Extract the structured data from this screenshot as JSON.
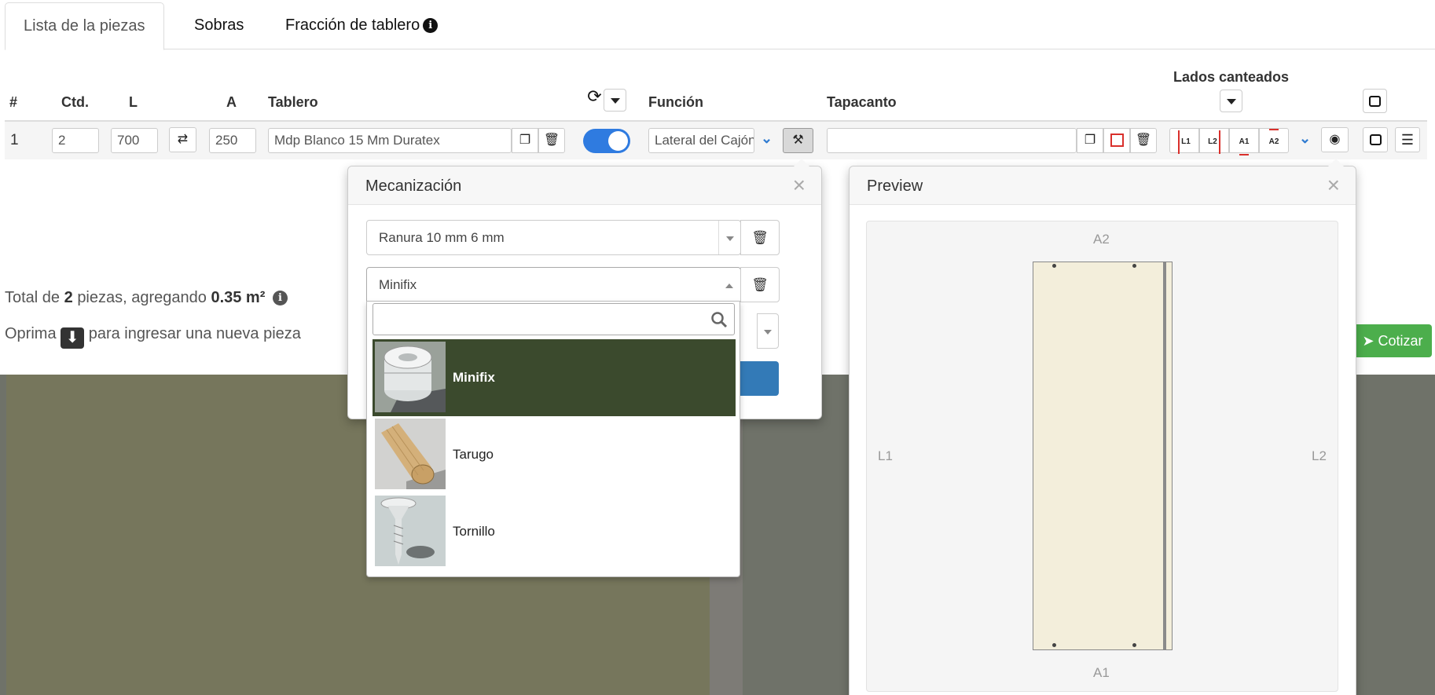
{
  "tabs": [
    {
      "label": "Lista de la piezas"
    },
    {
      "label": "Sobras"
    },
    {
      "label": "Fracción de tablero"
    }
  ],
  "table": {
    "headers": {
      "num": "#",
      "qty": "Ctd.",
      "length": "L",
      "width": "A",
      "board": "Tablero",
      "function": "Función",
      "edge_band": "Tapacanto",
      "edged_sides": "Lados canteados"
    },
    "row": {
      "index": "1",
      "qty": "2",
      "length": "700",
      "width": "250",
      "board": "Mdp Blanco 15 Mm Duratex",
      "function": "Lateral del Cajón",
      "edge_band": "",
      "rotation_enabled": true
    },
    "edge_buttons": [
      "L1",
      "L2",
      "A1",
      "A2"
    ]
  },
  "summary": {
    "prefix": "Total de",
    "count": "2",
    "middle": "piezas, agregando",
    "area": "0.35 m²",
    "hint_prefix": "Oprima",
    "hint_suffix": "para ingresar una nueva pieza"
  },
  "actions": {
    "quote": "Cotizar"
  },
  "machining": {
    "title": "Mecanización",
    "operations": [
      {
        "value": "Ranura 10 mm 6 mm"
      },
      {
        "value": "Minifix"
      }
    ],
    "search_value": "",
    "options": [
      {
        "label": "Minifix",
        "selected": true
      },
      {
        "label": "Tarugo",
        "selected": false
      },
      {
        "label": "Tornillo",
        "selected": false
      }
    ]
  },
  "preview": {
    "title": "Preview",
    "labels": {
      "top": "A2",
      "bottom": "A1",
      "left": "L1",
      "right": "L2"
    }
  },
  "colors": {
    "toggle": "#2f7be0",
    "selected_option": "#3b4a2d",
    "quote_button": "#4cae4c",
    "edge_red": "#d9302c"
  }
}
